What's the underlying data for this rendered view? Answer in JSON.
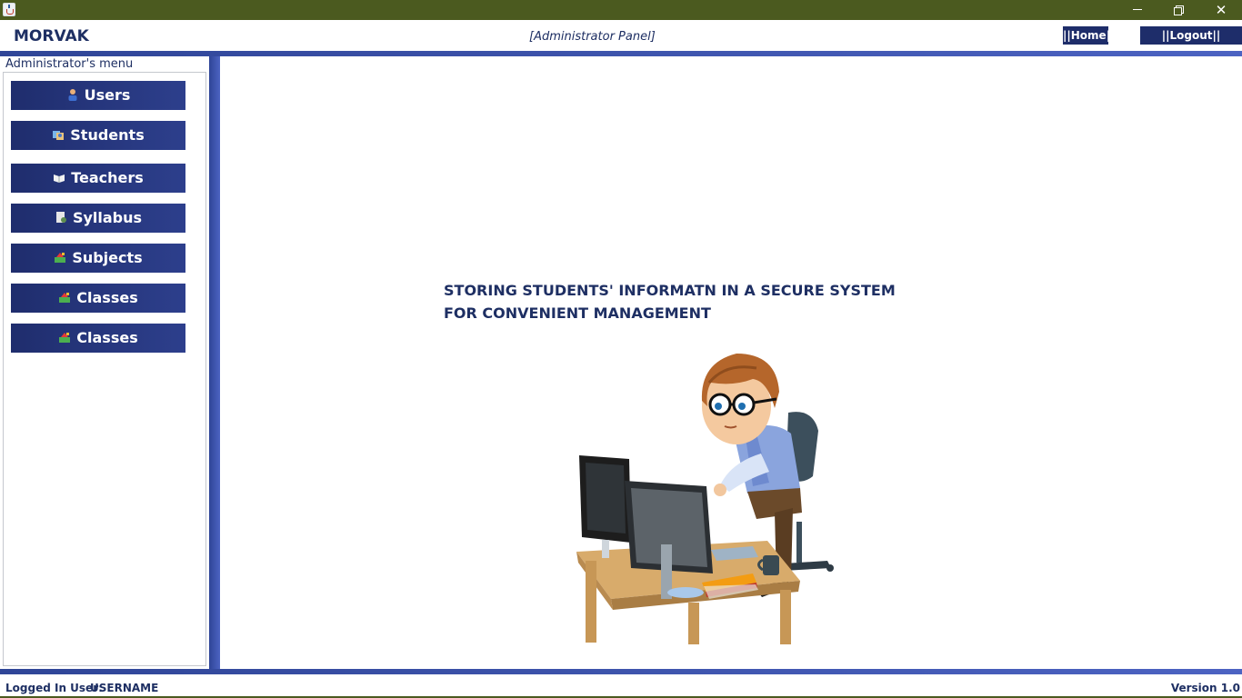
{
  "window": {
    "minimize_glyph": "",
    "close_glyph": "✕"
  },
  "header": {
    "brand": "MORVAK",
    "panel_title": "[Administrator Panel]",
    "home_label": "||Home||",
    "logout_label": "||Logout||"
  },
  "sidebar": {
    "title": "Administrator's menu",
    "items": [
      {
        "label": "Users",
        "icon": "user-icon"
      },
      {
        "label": "Students",
        "icon": "students-icon"
      },
      {
        "label": "Teachers",
        "icon": "book-icon"
      },
      {
        "label": "Syllabus",
        "icon": "syllabus-icon"
      },
      {
        "label": "Subjects",
        "icon": "subjects-icon"
      },
      {
        "label": "Classes",
        "icon": "classes-icon"
      },
      {
        "label": "Classes",
        "icon": "classes-icon"
      }
    ]
  },
  "main": {
    "tagline_line1": "STORING STUDENTS' INFORMATN IN A SECURE SYSTEM",
    "tagline_line2": "FOR CONVENIENT MANAGEMENT",
    "illustration_icon": "student-at-computer-illustration"
  },
  "status": {
    "logged_label": "Logged In User:",
    "username": "USERNAME",
    "version": "Version 1.0"
  },
  "colors": {
    "accent_blue": "#1e2d6a",
    "title_bar": "#4b5a1f",
    "text_navy": "#1e2f63"
  }
}
